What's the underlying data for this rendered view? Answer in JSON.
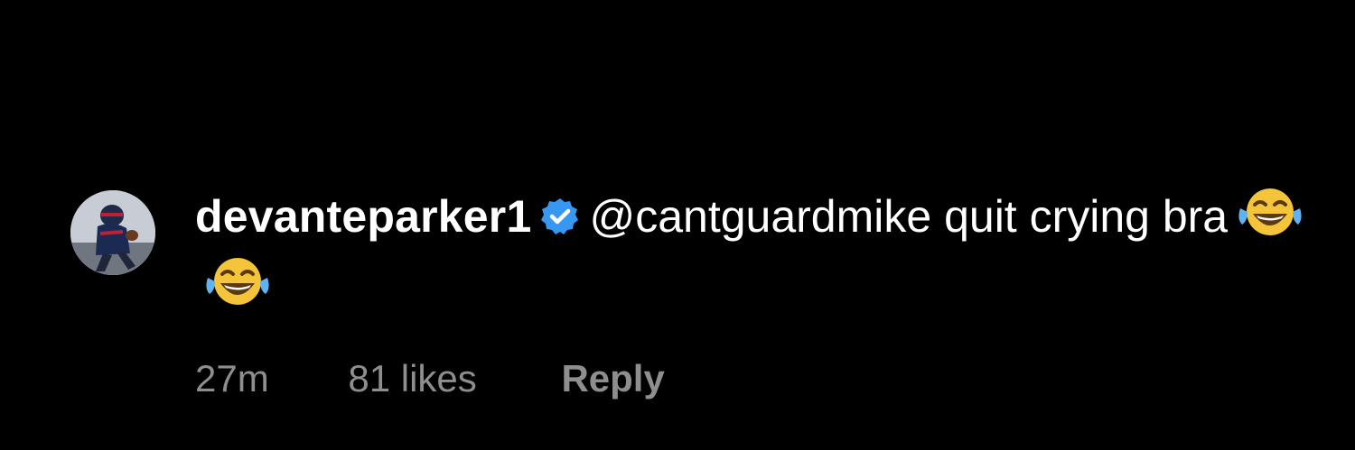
{
  "comment": {
    "username": "devanteparker1",
    "verified_icon": "verified-badge-icon",
    "mention": "@cantguardmike",
    "text_after_mention": " quit crying bra",
    "emojis": [
      "face-with-tears-of-joy",
      "face-with-tears-of-joy"
    ],
    "time": "27m",
    "likes": "81 likes",
    "reply_label": "Reply"
  },
  "colors": {
    "background": "#000000",
    "text": "#ffffff",
    "meta": "#8e8e8e",
    "verified": "#3897f0"
  }
}
